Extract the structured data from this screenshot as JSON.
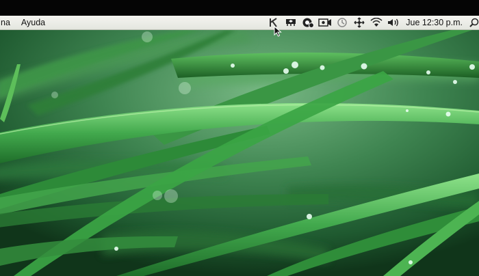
{
  "menubar": {
    "menus": [
      "na",
      "Ayuda"
    ],
    "status_icons": [
      "keyboard-k-icon",
      "cloud-server-icon",
      "creative-cloud-icon",
      "screen-record-icon",
      "time-machine-icon",
      "move-icon",
      "wifi-icon",
      "volume-icon"
    ],
    "clock": "Jue 12:30 p.m.",
    "search_icon": "spotlight-search-icon"
  },
  "desktop": {
    "wallpaper": "green grass blades with water droplets",
    "colors": {
      "light_green": "#7fc27f",
      "mid_green": "#3f8550",
      "dark_green": "#12391e",
      "menubar": "#ececE7"
    }
  }
}
